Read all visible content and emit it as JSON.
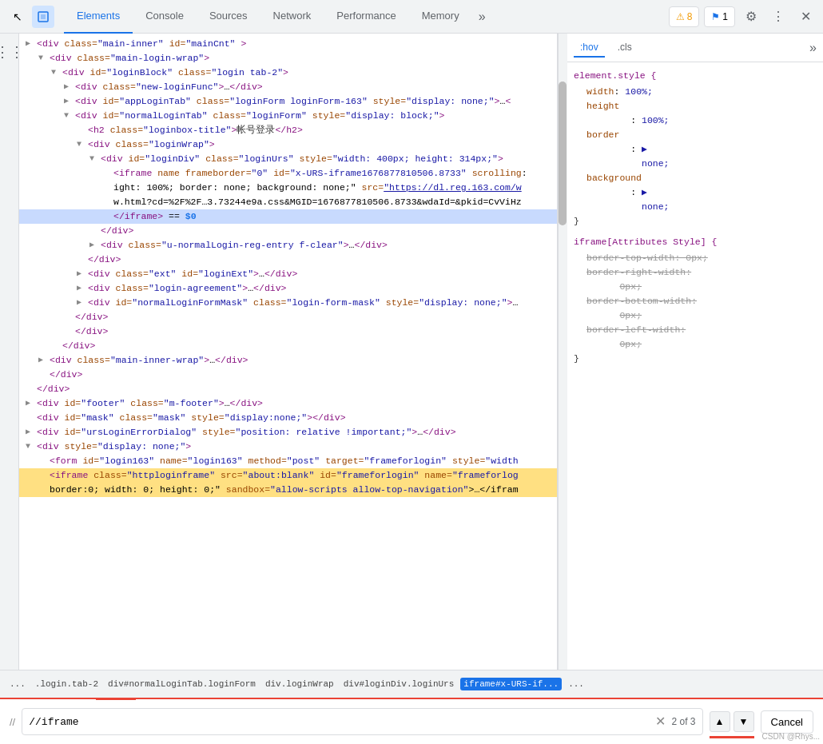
{
  "toolbar": {
    "cursor_icon": "↖",
    "inspect_icon": "⬜",
    "tabs": [
      {
        "label": "Elements",
        "active": true
      },
      {
        "label": "Console",
        "active": false
      },
      {
        "label": "Sources",
        "active": false
      },
      {
        "label": "Network",
        "active": false
      },
      {
        "label": "Performance",
        "active": false
      },
      {
        "label": "Memory",
        "active": false
      }
    ],
    "more_tabs": "»",
    "badge_warn_count": "8",
    "badge_warn_icon": "⚠",
    "badge_err_count": "1",
    "badge_err_icon": "⚑",
    "gear_icon": "⚙",
    "dots_icon": "⋮",
    "close_icon": "✕"
  },
  "styles_panel": {
    "tab_hov": ":hov",
    "tab_cls": ".cls",
    "more": "»",
    "sections": [
      {
        "selector": "element.style {",
        "properties": [
          {
            "prop": "width",
            "val": "100%;"
          },
          {
            "prop": "height",
            "val": "100%;"
          },
          {
            "prop": "border",
            "val": "none;"
          },
          {
            "prop": "background",
            "val": "none;"
          }
        ],
        "close": "}"
      },
      {
        "selector": "iframe[Attributes Style] {",
        "properties": [
          {
            "prop": "border-top-width",
            "val": "0px;",
            "strikethrough": true
          },
          {
            "prop": "border-right-width",
            "val": "0px;",
            "strikethrough": true
          },
          {
            "prop": "border-bottom-width",
            "val": "0px;",
            "strikethrough": true
          },
          {
            "prop": "border-left-width",
            "val": "0px;",
            "strikethrough": true
          }
        ],
        "close": "}"
      }
    ]
  },
  "breadcrumb": {
    "items": [
      {
        "label": "...",
        "active": false
      },
      {
        "label": ".login.tab-2",
        "active": false
      },
      {
        "label": "div#normalLoginTab.loginForm",
        "active": false
      },
      {
        "label": "div.loginWrap",
        "active": false
      },
      {
        "label": "div#loginDiv.loginUrs",
        "active": false
      },
      {
        "label": "iframe#x-URS-if...",
        "active": true
      },
      {
        "label": "...",
        "active": false
      }
    ]
  },
  "search": {
    "prefix": "//",
    "value": "//iframe",
    "results": "2 of 3",
    "cancel_label": "Cancel",
    "up_icon": "▲",
    "down_icon": "▼",
    "clear_icon": "✕"
  },
  "dom": {
    "lines": [
      {
        "indent": 0,
        "html": "<span class='tag'>&lt;div</span> <span class='attr-name'>class=</span><span class='attr-val'>\"main-inner\"</span> <span class='attr-name'>id=</span><span class='attr-val'>\"mainCnt\"</span> <span class='tag'>&gt;</span>",
        "arrow": "▶",
        "collapsed": true
      },
      {
        "indent": 1,
        "html": "<span class='tag'>&lt;div</span> <span class='attr-name'>class=</span><span class='attr-val'>\"main-login-wrap\"</span><span class='tag'>&gt;</span>",
        "arrow": "▼"
      },
      {
        "indent": 2,
        "html": "<span class='tag'>&lt;div</span> <span class='attr-name'>id=</span><span class='attr-val'>\"loginBlock\"</span> <span class='attr-name'>class=</span><span class='attr-val'>\"login tab-2\"</span><span class='tag'>&gt;</span>",
        "arrow": "▼"
      },
      {
        "indent": 3,
        "html": "<span class='tag'>&lt;div</span> <span class='attr-name'>class=</span><span class='attr-val'>\"new-loginFunc\"</span><span class='tag'>&gt;</span>…<span class='tag'>&lt;/div&gt;</span>",
        "arrow": "▶"
      },
      {
        "indent": 3,
        "html": "<span class='tag'>&lt;div</span> <span class='attr-name'>id=</span><span class='attr-val'>\"appLoginTab\"</span> <span class='attr-name'>class=</span><span class='attr-val'>\"loginForm loginForm-163\"</span> <span class='attr-name'>style=</span><span class='attr-val'>\"display: none;\"</span><span class='tag'>&gt;</span>…<span class='tag'>&lt;</span>",
        "arrow": "▶"
      },
      {
        "indent": 3,
        "html": "<span class='tag'>&lt;div</span> <span class='attr-name'>id=</span><span class='attr-val'>\"normalLoginTab\"</span> <span class='attr-name'>class=</span><span class='attr-val'>\"loginForm\"</span> <span class='attr-name'>style=</span><span class='attr-val'>\"display: block;\"</span><span class='tag'>&gt;</span>",
        "arrow": "▼"
      },
      {
        "indent": 4,
        "html": "<span class='tag'>&lt;h2</span> <span class='attr-name'>class=</span><span class='attr-val'>\"loginbox-title\"</span><span class='tag'>&gt;</span><span class='text-content'>帐号登录</span><span class='tag'>&lt;/h2&gt;</span>",
        "arrow": ""
      },
      {
        "indent": 4,
        "html": "<span class='tag'>&lt;div</span> <span class='attr-name'>class=</span><span class='attr-val'>\"loginWrap\"</span><span class='tag'>&gt;</span>",
        "arrow": "▼"
      },
      {
        "indent": 5,
        "html": "<span class='tag'>&lt;div</span> <span class='attr-name'>id=</span><span class='attr-val'>\"loginDiv\"</span> <span class='attr-name'>class=</span><span class='attr-val'>\"loginUrs\"</span> <span class='attr-name'>style=</span><span class='attr-val'>\"width: 400px; height: 314px;\"</span><span class='tag'>&gt;</span>",
        "arrow": "▼"
      },
      {
        "indent": 6,
        "html": "<span class='tag'>&lt;iframe</span> <span class='attr-name'>name</span> <span class='attr-name'>frameborder=</span><span class='attr-val'>\"0\"</span> <span class='attr-name'>id=</span><span class='attr-val'>\"x-URS-iframe1676877810506.8733\"</span> <span class='attr-name'>scrolling</span>:",
        "arrow": ""
      },
      {
        "indent": 6,
        "html": "ight: 100%; border: none; background: none;\" <span class='attr-name'>src=</span><span class='link'>\"https://dl.reg.163.com/w</span>",
        "arrow": ""
      },
      {
        "indent": 6,
        "html": "w.html?cd=%2F%2F…3.73244e9a.css&amp;MGID=1676877810506.8733&amp;wdaId=&amp;pkid=CvViHz",
        "arrow": ""
      },
      {
        "indent": 6,
        "html": "<span class='tag'>&lt;/iframe&gt;</span> == <span class='selected-pseudo'>$0</span>",
        "arrow": "",
        "selected": true
      },
      {
        "indent": 5,
        "html": "<span class='tag'>&lt;/div&gt;</span>",
        "arrow": ""
      },
      {
        "indent": 5,
        "html": "<span class='tag'>&lt;div</span> <span class='attr-name'>class=</span><span class='attr-val'>\"u-normalLogin-reg-entry f-clear\"</span><span class='tag'>&gt;</span>…<span class='tag'>&lt;/div&gt;</span>",
        "arrow": "▶"
      },
      {
        "indent": 4,
        "html": "<span class='tag'>&lt;/div&gt;</span>",
        "arrow": ""
      },
      {
        "indent": 4,
        "html": "<span class='tag'>&lt;div</span> <span class='attr-name'>class=</span><span class='attr-val'>\"ext\"</span> <span class='attr-name'>id=</span><span class='attr-val'>\"loginExt\"</span><span class='tag'>&gt;</span>…<span class='tag'>&lt;/div&gt;</span>",
        "arrow": "▶"
      },
      {
        "indent": 4,
        "html": "<span class='tag'>&lt;div</span> <span class='attr-name'>class=</span><span class='attr-val'>\"login-agreement\"</span><span class='tag'>&gt;</span>…<span class='tag'>&lt;/div&gt;</span>",
        "arrow": "▶"
      },
      {
        "indent": 4,
        "html": "<span class='tag'>&lt;div</span> <span class='attr-name'>id=</span><span class='attr-val'>\"normalLoginFormMask\"</span> <span class='attr-name'>class=</span><span class='attr-val'>\"login-form-mask\"</span> <span class='attr-name'>style=</span><span class='attr-val'>\"display: none;\"</span><span class='tag'>&gt;</span>…",
        "arrow": "▶"
      },
      {
        "indent": 3,
        "html": "<span class='tag'>&lt;/div&gt;</span>",
        "arrow": ""
      },
      {
        "indent": 3,
        "html": "<span class='tag'>&lt;/div&gt;</span>",
        "arrow": ""
      },
      {
        "indent": 2,
        "html": "<span class='tag'>&lt;/div&gt;</span>",
        "arrow": ""
      },
      {
        "indent": 1,
        "html": "<span class='tag'>&lt;div</span> <span class='attr-name'>class=</span><span class='attr-val'>\"main-inner-wrap\"</span><span class='tag'>&gt;</span>…<span class='tag'>&lt;/div&gt;</span>",
        "arrow": "▶"
      },
      {
        "indent": 1,
        "html": "<span class='tag'>&lt;/div&gt;</span>",
        "arrow": ""
      },
      {
        "indent": 0,
        "html": "<span class='tag'>&lt;/div&gt;</span>",
        "arrow": ""
      },
      {
        "indent": 0,
        "html": "<span class='tag'>&lt;div</span> <span class='attr-name'>id=</span><span class='attr-val'>\"footer\"</span> <span class='attr-name'>class=</span><span class='attr-val'>\"m-footer\"</span><span class='tag'>&gt;</span>…<span class='tag'>&lt;/div&gt;</span>",
        "arrow": "▶"
      },
      {
        "indent": 0,
        "html": "<span class='tag'>&lt;div</span> <span class='attr-name'>id=</span><span class='attr-val'>\"mask\"</span> <span class='attr-name'>class=</span><span class='attr-val'>\"mask\"</span> <span class='attr-name'>style=</span><span class='attr-val'>\"display:none;\"</span><span class='tag'>&gt;&lt;/div&gt;</span>",
        "arrow": ""
      },
      {
        "indent": 0,
        "html": "<span class='tag'>&lt;div</span> <span class='attr-name'>id=</span><span class='attr-val'>\"ursLoginErrorDialog\"</span> <span class='attr-name'>style=</span><span class='attr-val'>\"position: relative !important;\"</span><span class='tag'>&gt;</span>…<span class='tag'>&lt;/div&gt;</span>",
        "arrow": "▶"
      },
      {
        "indent": 0,
        "html": "<span class='tag'>&lt;div</span> <span class='attr-name'>style=</span><span class='attr-val'>\"display: none;\"</span><span class='tag'>&gt;</span>",
        "arrow": "▼"
      },
      {
        "indent": 1,
        "html": "<span class='tag'>&lt;form</span> <span class='attr-name'>id=</span><span class='attr-val'>\"login163\"</span> <span class='attr-name'>name=</span><span class='attr-val'>\"login163\"</span> <span class='attr-name'>method=</span><span class='attr-val'>\"post\"</span> <span class='attr-name'>target=</span><span class='attr-val'>\"frameforlogin\"</span> <span class='attr-name'>style=</span><span class='attr-val'>\"width</span>",
        "arrow": ""
      },
      {
        "indent": 1,
        "html": "<span class='tag' style='background:#ffe082'>&lt;iframe</span><span style='background:#ffe082'> <span class='attr-name'>class=</span><span class='attr-val'>\"httploginframe\"</span> <span class='attr-name'>src=</span><span class='attr-val'>\"about:blank\"</span> <span class='attr-name'>id=</span><span class='attr-val'>\"frameforlogin\"</span> <span class='attr-name'>name=</span><span class='attr-val'>\"frameforlog</span></span>",
        "arrow": "",
        "highlighted": true
      },
      {
        "indent": 1,
        "html": "<span style='background:#ffe082'>border:0; width: 0; height: 0;\" <span class='attr-name'>sandbox=</span><span class='attr-val'>\"allow-scripts allow-top-navigation\"</span>&gt;…&lt;/ifram</span>",
        "arrow": "",
        "highlighted": true
      }
    ]
  },
  "watermark": "CSDN @Rhys..."
}
